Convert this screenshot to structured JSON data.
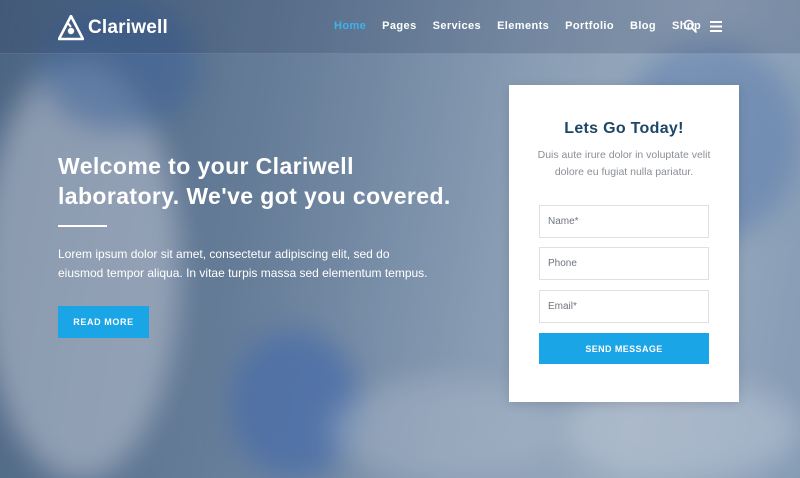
{
  "brand": {
    "name": "Clariwell",
    "accent": "#1aa5e6",
    "active_nav": "#3fb2ec",
    "title_color": "#1d4766"
  },
  "nav": {
    "items": [
      "Home",
      "Pages",
      "Services",
      "Elements",
      "Portfolio",
      "Blog",
      "Shop"
    ],
    "active": "Home",
    "icons": [
      "search-icon",
      "hamburger-menu-icon"
    ]
  },
  "hero": {
    "title": "Welcome to your Clariwell laboratory. We've got you covered.",
    "text": "Lorem ipsum dolor sit amet, consectetur adipiscing elit, sed do eiusmod tempor aliqua. In vitae turpis massa sed elementum tempus.",
    "button": "READ MORE"
  },
  "form": {
    "title": "Lets Go Today!",
    "subtitle": "Duis aute irure dolor in voluptate velit dolore eu fugiat nulla pariatur.",
    "name_placeholder": "Name*",
    "phone_placeholder": "Phone",
    "email_placeholder": "Email*",
    "submit": "SEND MESSAGE"
  }
}
